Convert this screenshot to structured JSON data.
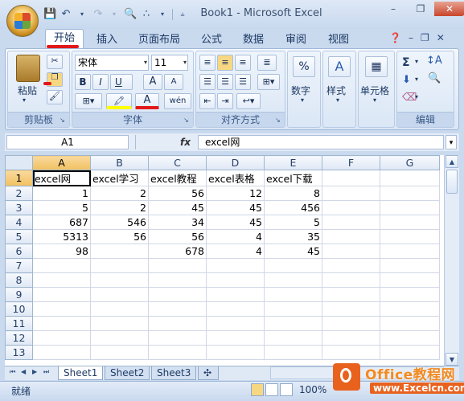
{
  "window": {
    "title": "Book1 - Microsoft Excel"
  },
  "tabs": [
    "开始",
    "插入",
    "页面布局",
    "公式",
    "数据",
    "审阅",
    "视图"
  ],
  "ribbon": {
    "clipboard": {
      "paste_label": "粘贴",
      "group_title": "剪贴板"
    },
    "font": {
      "name": "宋体",
      "size": "11",
      "bold": "B",
      "italic": "I",
      "underline": "U",
      "grow": "A",
      "shrink": "A",
      "highlight_color": "#ffff00",
      "font_color": "#e21818",
      "wen": "wén",
      "group_title": "字体"
    },
    "alignment": {
      "group_title": "对齐方式"
    },
    "number": {
      "label": "数字",
      "icon": "%"
    },
    "styles": {
      "label": "样式"
    },
    "cells": {
      "label": "单元格"
    },
    "editing": {
      "group_title": "编辑",
      "sum_icon": "Σ"
    }
  },
  "formula_bar": {
    "name_box": "A1",
    "fx": "fx",
    "content": "excel网"
  },
  "grid": {
    "columns": [
      "A",
      "B",
      "C",
      "D",
      "E",
      "F",
      "G"
    ],
    "rows": [
      [
        "excel网",
        "excel学习",
        "excel教程",
        "excel表格",
        "excel下载",
        "",
        ""
      ],
      [
        "1",
        "2",
        "56",
        "12",
        "8",
        "",
        ""
      ],
      [
        "5",
        "2",
        "45",
        "45",
        "456",
        "",
        ""
      ],
      [
        "687",
        "546",
        "34",
        "45",
        "5",
        "",
        ""
      ],
      [
        "5313",
        "56",
        "56",
        "4",
        "35",
        "",
        ""
      ],
      [
        "98",
        "",
        "678",
        "4",
        "45",
        "",
        ""
      ],
      [
        "",
        "",
        "",
        "",
        "",
        "",
        ""
      ],
      [
        "",
        "",
        "",
        "",
        "",
        "",
        ""
      ],
      [
        "",
        "",
        "",
        "",
        "",
        "",
        ""
      ],
      [
        "",
        "",
        "",
        "",
        "",
        "",
        ""
      ],
      [
        "",
        "",
        "",
        "",
        "",
        "",
        ""
      ],
      [
        "",
        "",
        "",
        "",
        "",
        "",
        ""
      ],
      [
        "",
        "",
        "",
        "",
        "",
        "",
        ""
      ]
    ],
    "row_numbers": [
      "1",
      "2",
      "3",
      "4",
      "5",
      "6",
      "7",
      "8",
      "9",
      "10",
      "11",
      "12",
      "13"
    ]
  },
  "sheets": [
    "Sheet1",
    "Sheet2",
    "Sheet3"
  ],
  "status": {
    "text": "就绪",
    "zoom": "100%"
  },
  "watermark": {
    "title": "Office教程网",
    "url": "www.Excelcn.com"
  }
}
